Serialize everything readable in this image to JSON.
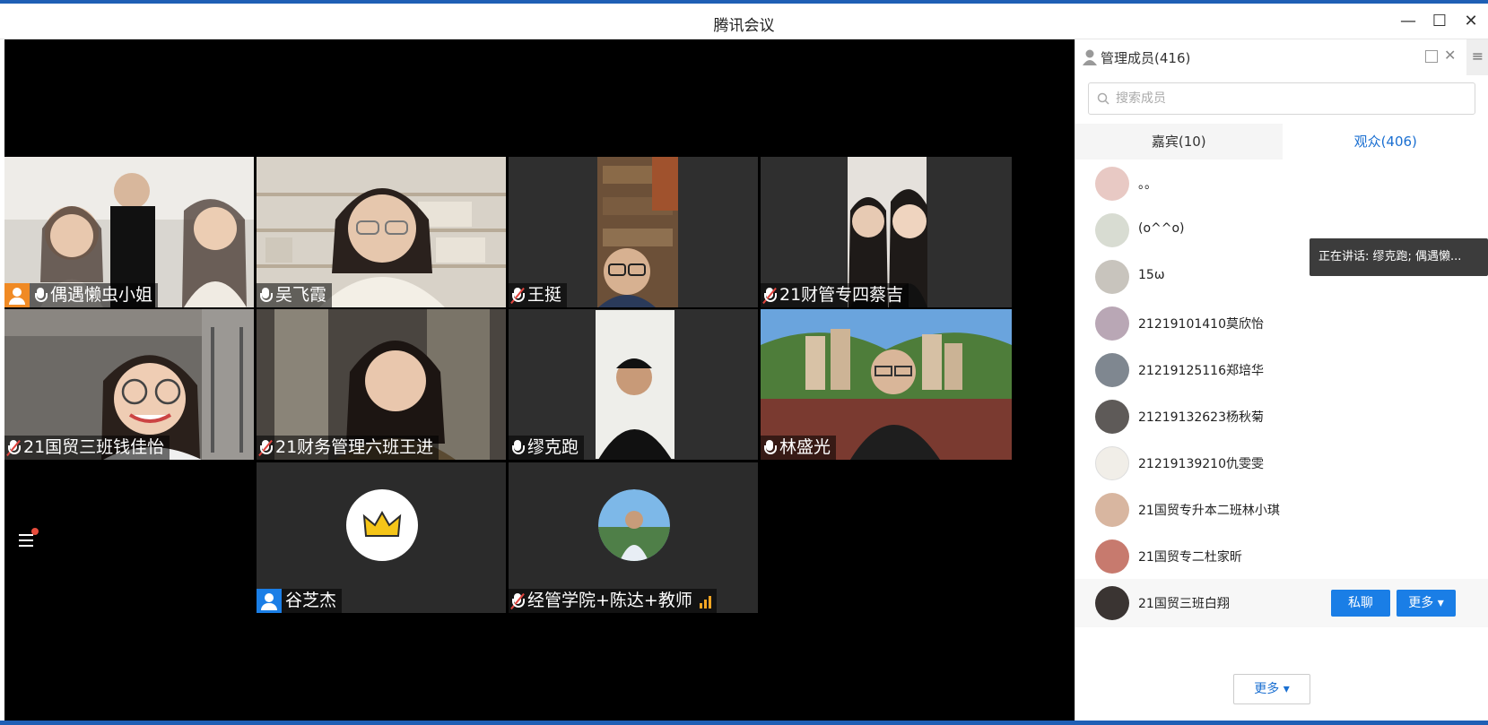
{
  "app": {
    "title": "腾讯会议"
  },
  "grid": {
    "row1": [
      {
        "name": "偶遇懒虫小姐",
        "host": true
      },
      {
        "name": "吴飞霞",
        "muted": false
      },
      {
        "name": "王挺",
        "muted": true
      },
      {
        "name": "21财管专四蔡吉",
        "muted": true
      }
    ],
    "row2": [
      {
        "name": "21国贸三班钱佳怡",
        "muted": true
      },
      {
        "name": "21财务管理六班王进",
        "muted": true
      },
      {
        "name": "缪克跑",
        "muted": false,
        "active": true
      },
      {
        "name": "林盛光",
        "muted": false
      }
    ],
    "row3": [
      {
        "name": "谷芝杰",
        "host": true,
        "avatar": "crown"
      },
      {
        "name": "经管学院+陈达+教师",
        "muted": true,
        "signal": true
      }
    ]
  },
  "panel": {
    "title": "管理成员(416)",
    "search_placeholder": "搜索成员",
    "tabs": [
      {
        "label": "嘉宾(10)",
        "active": false
      },
      {
        "label": "观众(406)",
        "active": true
      }
    ],
    "members": [
      {
        "name": "。。"
      },
      {
        "name": "(o^^o)"
      },
      {
        "name": "15ω"
      },
      {
        "name": "21219101410莫欣怡"
      },
      {
        "name": "21219125116郑培华"
      },
      {
        "name": "21219132623杨秋菊"
      },
      {
        "name": "21219139210仇雯雯"
      },
      {
        "name": "21国贸专升本二班林小琪"
      },
      {
        "name": "21国贸专二杜家昕"
      },
      {
        "name": "21国贸三班白翔"
      }
    ],
    "private_chat_label": "私聊",
    "member_more_label": "更多",
    "more_label": "更多"
  },
  "tooltip": {
    "speaking": "正在讲话: 缪克跑; 偶遇懒..."
  },
  "colors": {
    "accent": "#1a7ee6",
    "tab_active": "#1a6fd1"
  }
}
